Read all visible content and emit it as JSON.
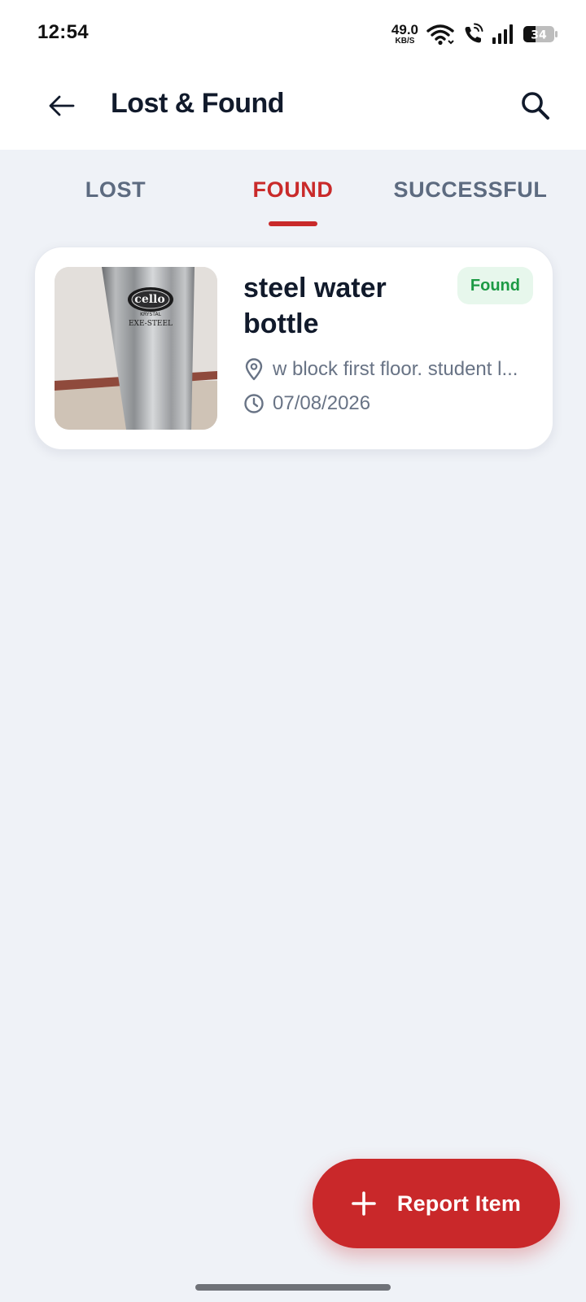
{
  "status_bar": {
    "time": "12:54",
    "net_speed_value": "49.0",
    "net_speed_unit": "KB/S",
    "battery_level": "34",
    "icons": [
      "wifi-icon",
      "wifi-calling-icon",
      "signal-icon",
      "battery-icon"
    ]
  },
  "app_bar": {
    "title": "Lost & Found",
    "back_icon": "arrow-left-icon",
    "search_icon": "search-icon"
  },
  "tabs": [
    {
      "label": "LOST",
      "selected": false
    },
    {
      "label": "FOUND",
      "selected": true
    },
    {
      "label": "SUCCESSFUL",
      "selected": false
    }
  ],
  "items": [
    {
      "title": "steel water bottle",
      "status": "Found",
      "location": "w block first floor. student l...",
      "date": "07/08/2026",
      "image_alt": "steel water bottle photo",
      "brand_marks": {
        "logo": "cello",
        "sub": "KRYSTAL",
        "line": "EXE-STEEL"
      }
    }
  ],
  "fab": {
    "label": "Report Item",
    "icon": "plus-icon"
  },
  "colors": {
    "accent": "#c92a2a",
    "background": "#eff2f7",
    "badge_bg": "#e7f7ec",
    "badge_text": "#1c9a44",
    "muted_text": "#687385"
  }
}
